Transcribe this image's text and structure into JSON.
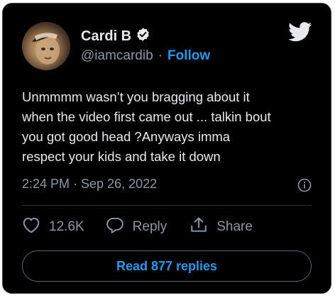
{
  "user": {
    "display_name": "Cardi B",
    "handle": "@iamcardib",
    "separator": "·",
    "follow_label": "Follow"
  },
  "tweet": {
    "text": "Unmmmm wasn’t you bragging about it\nwhen the video first came out ... talkin bout\nyou got good head ?Anyways imma\nrespect your kids and take it down",
    "timestamp": "2:24 PM · Sep 26, 2022"
  },
  "actions": {
    "like_count": "12.6K",
    "reply_label": "Reply",
    "share_label": "Share"
  },
  "read_replies_label": "Read 877 replies",
  "icons": {
    "verified": "verified-badge-icon",
    "brand": "twitter-bird-icon",
    "info": "info-icon",
    "like": "heart-icon",
    "reply": "speech-bubble-icon",
    "share": "share-upload-icon"
  },
  "colors": {
    "background": "#000000",
    "text": "#e7e9ea",
    "secondary_text": "#8b98a5",
    "accent": "#1d9bf0"
  }
}
